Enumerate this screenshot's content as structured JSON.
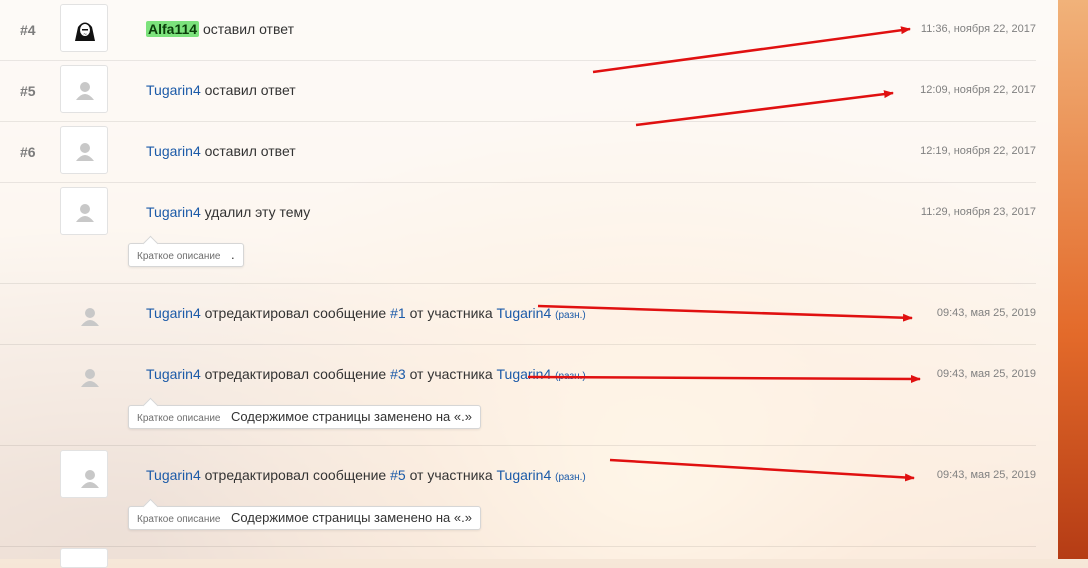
{
  "entries": [
    {
      "num": "#4",
      "user": "Alfa114",
      "action": "оставил ответ",
      "time": "11:36, ноября 22, 2017"
    },
    {
      "num": "#5",
      "user": "Tugarin4",
      "action": "оставил ответ",
      "time": "12:09, ноября 22, 2017"
    },
    {
      "num": "#6",
      "user": "Tugarin4",
      "action": "оставил ответ",
      "time": "12:19, ноября 22, 2017"
    },
    {
      "user": "Tugarin4",
      "action": "удалил эту тему",
      "time": "11:29, ноября 23, 2017",
      "summary_label": "Краткое описание",
      "summary_value": "."
    },
    {
      "user": "Tugarin4",
      "action": "отредактировал сообщение",
      "post": "#1",
      "from": "от участника",
      "target": "Tugarin4",
      "diff": "(разн.)",
      "time": "09:43, мая 25, 2019"
    },
    {
      "user": "Tugarin4",
      "action": "отредактировал сообщение",
      "post": "#3",
      "from": "от участника",
      "target": "Tugarin4",
      "diff": "(разн.)",
      "time": "09:43, мая 25, 2019",
      "summary_label": "Краткое описание",
      "summary_value": "Содержимое страницы заменено на «.»"
    },
    {
      "user": "Tugarin4",
      "action": "отредактировал сообщение",
      "post": "#5",
      "from": "от участника",
      "target": "Tugarin4",
      "diff": "(разн.)",
      "time": "09:43, мая 25, 2019",
      "summary_label": "Краткое описание",
      "summary_value": "Содержимое страницы заменено на «.»"
    }
  ],
  "colors": {
    "link": "#1b5aa8",
    "highlight": "#7ce27c",
    "arrow": "#e01010"
  }
}
